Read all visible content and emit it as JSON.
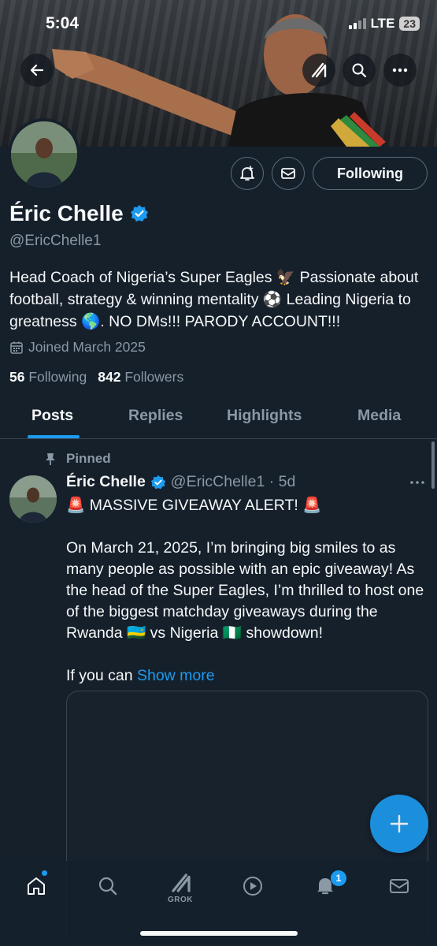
{
  "status_bar": {
    "time": "5:04",
    "network": "LTE",
    "battery": "23"
  },
  "profile": {
    "name": "Éric Chelle",
    "handle": "@EricChelle1",
    "bio": "Head Coach of Nigeria’s Super Eagles 🦅 Passionate about football, strategy & winning mentality ⚽ Leading Nigeria to greatness 🌎. NO DMs!!! PARODY ACCOUNT!!!",
    "joined": "Joined March 2025",
    "following_count": "56",
    "following_label": "Following",
    "followers_count": "842",
    "followers_label": "Followers",
    "follow_button": "Following"
  },
  "tabs": [
    "Posts",
    "Replies",
    "Highlights",
    "Media"
  ],
  "post": {
    "pinned_label": "Pinned",
    "author": "Éric Chelle",
    "handle_time": "@EricChelle1 · 5d",
    "text": "🚨 MASSIVE GIVEAWAY ALERT! 🚨\n\nOn March 21, 2025, I’m bringing big smiles to as many people as possible with an epic giveaway! As the head of the Super Eagles, I’m thrilled to host one of the biggest matchday giveaways during the Rwanda 🇷🇼 vs Nigeria 🇳🇬 showdown!\n\nIf you can ",
    "show_more": "Show more"
  },
  "nav": {
    "grok_label": "GROK",
    "notifications_badge": "1"
  },
  "colors": {
    "background": "#15202b",
    "accent": "#1d9bf0",
    "muted": "#8b98a5",
    "border": "#38444d"
  },
  "icons": [
    "back-arrow-icon",
    "grok-icon",
    "search-icon",
    "more-icon",
    "notification-bell-icon",
    "mail-icon",
    "verified-badge-icon",
    "calendar-icon",
    "pin-icon",
    "plus-icon",
    "home-icon",
    "play-icon"
  ]
}
